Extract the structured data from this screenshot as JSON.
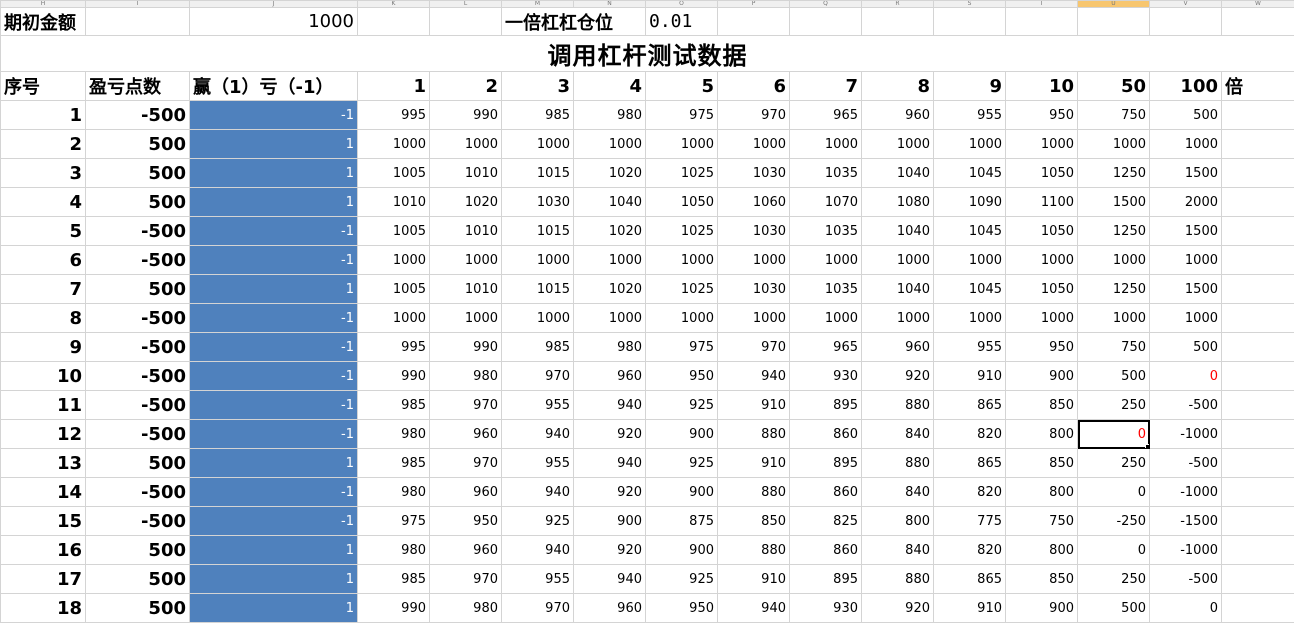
{
  "col_letters": [
    "H",
    "I",
    "J",
    "K",
    "L",
    "M",
    "N",
    "O",
    "P",
    "Q",
    "R",
    "S",
    "T",
    "U",
    "V",
    "W"
  ],
  "colors": {
    "blue_fill": "#4f81bd",
    "negative_zero": "#ff0000",
    "selected_col": "#f7c66f"
  },
  "top": {
    "init_label": "期初金额",
    "init_value": "1000",
    "leverage_label": "一倍杠杠仓位",
    "leverage_value": "0.01"
  },
  "title": "调用杠杆测试数据",
  "headers": {
    "seq": "序号",
    "pnl": "盈亏点数",
    "winloss": "赢（1）亏（-1）",
    "multipliers": [
      "1",
      "2",
      "3",
      "4",
      "5",
      "6",
      "7",
      "8",
      "9",
      "10",
      "50",
      "100"
    ],
    "times": "倍"
  },
  "rows": [
    {
      "n": "1",
      "p": "-500",
      "w": "-1",
      "v": [
        "995",
        "990",
        "985",
        "980",
        "975",
        "970",
        "965",
        "960",
        "955",
        "950",
        "750",
        "500"
      ]
    },
    {
      "n": "2",
      "p": "500",
      "w": "1",
      "v": [
        "1000",
        "1000",
        "1000",
        "1000",
        "1000",
        "1000",
        "1000",
        "1000",
        "1000",
        "1000",
        "1000",
        "1000"
      ]
    },
    {
      "n": "3",
      "p": "500",
      "w": "1",
      "v": [
        "1005",
        "1010",
        "1015",
        "1020",
        "1025",
        "1030",
        "1035",
        "1040",
        "1045",
        "1050",
        "1250",
        "1500"
      ]
    },
    {
      "n": "4",
      "p": "500",
      "w": "1",
      "v": [
        "1010",
        "1020",
        "1030",
        "1040",
        "1050",
        "1060",
        "1070",
        "1080",
        "1090",
        "1100",
        "1500",
        "2000"
      ]
    },
    {
      "n": "5",
      "p": "-500",
      "w": "-1",
      "v": [
        "1005",
        "1010",
        "1015",
        "1020",
        "1025",
        "1030",
        "1035",
        "1040",
        "1045",
        "1050",
        "1250",
        "1500"
      ]
    },
    {
      "n": "6",
      "p": "-500",
      "w": "-1",
      "v": [
        "1000",
        "1000",
        "1000",
        "1000",
        "1000",
        "1000",
        "1000",
        "1000",
        "1000",
        "1000",
        "1000",
        "1000"
      ]
    },
    {
      "n": "7",
      "p": "500",
      "w": "1",
      "v": [
        "1005",
        "1010",
        "1015",
        "1020",
        "1025",
        "1030",
        "1035",
        "1040",
        "1045",
        "1050",
        "1250",
        "1500"
      ]
    },
    {
      "n": "8",
      "p": "-500",
      "w": "-1",
      "v": [
        "1000",
        "1000",
        "1000",
        "1000",
        "1000",
        "1000",
        "1000",
        "1000",
        "1000",
        "1000",
        "1000",
        "1000"
      ]
    },
    {
      "n": "9",
      "p": "-500",
      "w": "-1",
      "v": [
        "995",
        "990",
        "985",
        "980",
        "975",
        "970",
        "965",
        "960",
        "955",
        "950",
        "750",
        "500"
      ]
    },
    {
      "n": "10",
      "p": "-500",
      "w": "-1",
      "v": [
        "990",
        "980",
        "970",
        "960",
        "950",
        "940",
        "930",
        "920",
        "910",
        "900",
        "500",
        "0"
      ]
    },
    {
      "n": "11",
      "p": "-500",
      "w": "-1",
      "v": [
        "985",
        "970",
        "955",
        "940",
        "925",
        "910",
        "895",
        "880",
        "865",
        "850",
        "250",
        "-500"
      ]
    },
    {
      "n": "12",
      "p": "-500",
      "w": "-1",
      "v": [
        "980",
        "960",
        "940",
        "920",
        "900",
        "880",
        "860",
        "840",
        "820",
        "800",
        "0",
        "-1000"
      ]
    },
    {
      "n": "13",
      "p": "500",
      "w": "1",
      "v": [
        "985",
        "970",
        "955",
        "940",
        "925",
        "910",
        "895",
        "880",
        "865",
        "850",
        "250",
        "-500"
      ]
    },
    {
      "n": "14",
      "p": "-500",
      "w": "-1",
      "v": [
        "980",
        "960",
        "940",
        "920",
        "900",
        "880",
        "860",
        "840",
        "820",
        "800",
        "0",
        "-1000"
      ]
    },
    {
      "n": "15",
      "p": "-500",
      "w": "-1",
      "v": [
        "975",
        "950",
        "925",
        "900",
        "875",
        "850",
        "825",
        "800",
        "775",
        "750",
        "-250",
        "-1500"
      ]
    },
    {
      "n": "16",
      "p": "500",
      "w": "1",
      "v": [
        "980",
        "960",
        "940",
        "920",
        "900",
        "880",
        "860",
        "840",
        "820",
        "800",
        "0",
        "-1000"
      ]
    },
    {
      "n": "17",
      "p": "500",
      "w": "1",
      "v": [
        "985",
        "970",
        "955",
        "940",
        "925",
        "910",
        "895",
        "880",
        "865",
        "850",
        "250",
        "-500"
      ]
    },
    {
      "n": "18",
      "p": "500",
      "w": "1",
      "v": [
        "990",
        "980",
        "970",
        "960",
        "950",
        "940",
        "930",
        "920",
        "910",
        "900",
        "500",
        "0"
      ]
    }
  ],
  "red_cells": [
    [
      9,
      11
    ],
    [
      11,
      10
    ]
  ],
  "selected_cell": [
    11,
    10
  ]
}
